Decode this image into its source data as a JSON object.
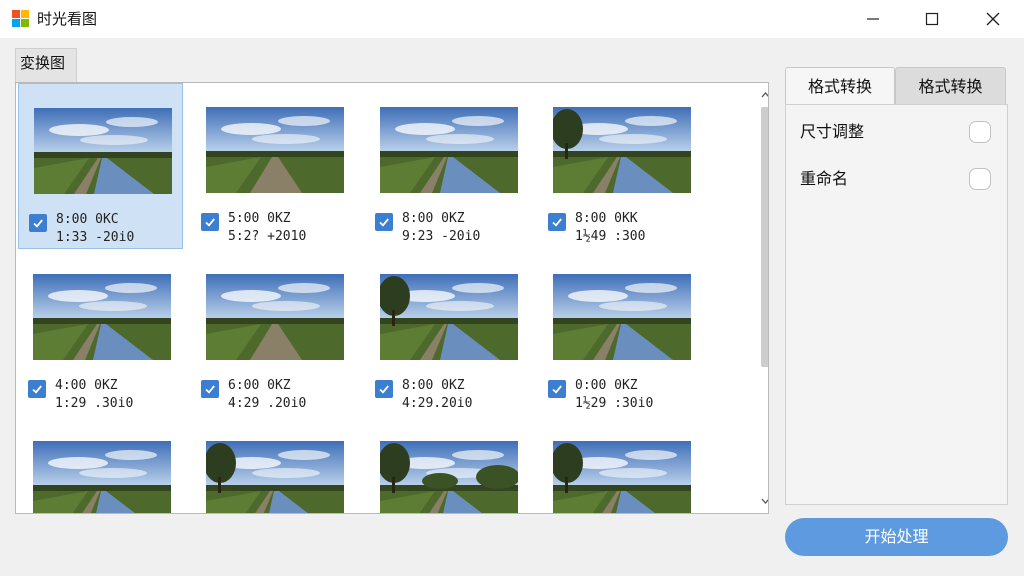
{
  "window": {
    "title": "时光看图",
    "controls": [
      "minimize",
      "maximize",
      "close"
    ]
  },
  "gallery": {
    "group_label": "変换图",
    "items": [
      {
        "time": "8:00 0KC",
        "detail": "1:33 -20i0",
        "checked": true,
        "selected": true,
        "scene": "sky"
      },
      {
        "time": "5:00 0KZ",
        "detail": "5:2? +2010",
        "checked": true,
        "selected": false,
        "scene": "road"
      },
      {
        "time": "8:00 0KZ",
        "detail": "9:23 -20i0",
        "checked": true,
        "selected": false,
        "scene": "canal"
      },
      {
        "time": "8:00 0KK",
        "detail": "1½49 :300",
        "checked": true,
        "selected": false,
        "scene": "tree"
      },
      {
        "time": "4:00 0KZ",
        "detail": "1:29 .30i0",
        "checked": true,
        "selected": false,
        "scene": "canal"
      },
      {
        "time": "6:00 0KZ",
        "detail": "4:29 .20i0",
        "checked": true,
        "selected": false,
        "scene": "road"
      },
      {
        "time": "8:00 0KZ",
        "detail": "4:29.20i0",
        "checked": true,
        "selected": false,
        "scene": "tree"
      },
      {
        "time": "0:00 0KZ",
        "detail": "1½29 :30i0",
        "checked": true,
        "selected": false,
        "scene": "canal"
      },
      {
        "time": "",
        "detail": "",
        "checked": false,
        "selected": false,
        "scene": "sky"
      },
      {
        "time": "",
        "detail": "",
        "checked": false,
        "selected": false,
        "scene": "tree"
      },
      {
        "time": "",
        "detail": "",
        "checked": false,
        "selected": false,
        "scene": "forest"
      },
      {
        "time": "",
        "detail": "",
        "checked": false,
        "selected": false,
        "scene": "tree"
      }
    ]
  },
  "side_panel": {
    "tabs": [
      "格式转换",
      "格式转换"
    ],
    "active_tab": 0,
    "options": [
      {
        "label": "尺寸调整",
        "enabled": false
      },
      {
        "label": "重命名",
        "enabled": false
      }
    ]
  },
  "actions": {
    "start_label": "开始处理"
  },
  "colors": {
    "accent": "#5e9ae0",
    "checkbox": "#3c7fd0",
    "selection": "#cfe2f5"
  },
  "icons": {
    "app": "app-logo-icon",
    "minimize": "minimize-icon",
    "maximize": "maximize-icon",
    "close": "close-icon",
    "check": "checkmark-icon",
    "scroll_up": "chevron-up-icon",
    "scroll_down": "chevron-down-icon"
  }
}
